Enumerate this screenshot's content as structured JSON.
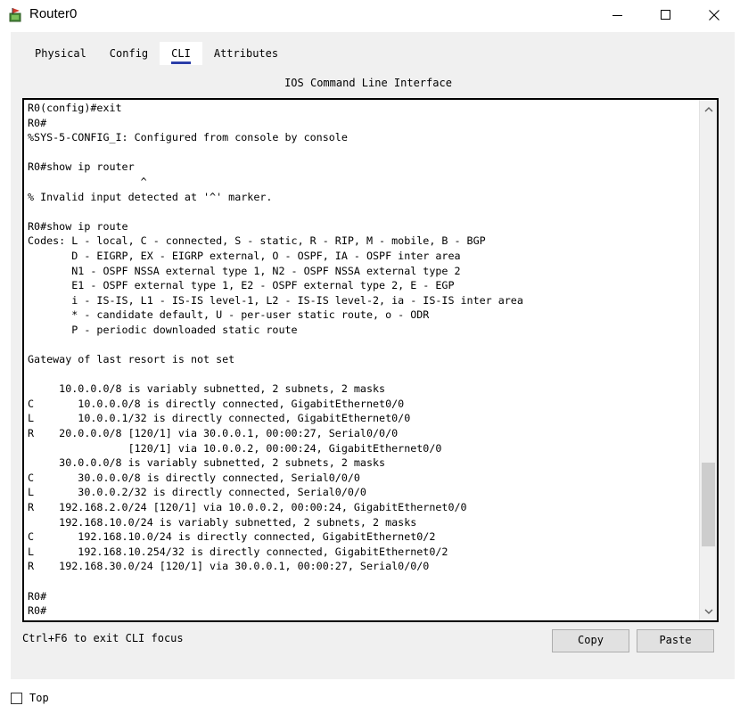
{
  "window": {
    "title": "Router0",
    "icon": "router-app-icon",
    "controls": [
      "minimize-icon",
      "maximize-icon",
      "close-icon"
    ]
  },
  "tabs": [
    {
      "label": "Physical",
      "active": false
    },
    {
      "label": "Config",
      "active": false
    },
    {
      "label": "CLI",
      "active": true
    },
    {
      "label": "Attributes",
      "active": false
    }
  ],
  "cli": {
    "heading": "IOS Command Line Interface",
    "lines": [
      "R0(config)#exit",
      "R0#",
      "%SYS-5-CONFIG_I: Configured from console by console",
      "",
      "R0#show ip router",
      "                  ^",
      "% Invalid input detected at '^' marker.",
      "",
      "R0#show ip route",
      "Codes: L - local, C - connected, S - static, R - RIP, M - mobile, B - BGP",
      "       D - EIGRP, EX - EIGRP external, O - OSPF, IA - OSPF inter area",
      "       N1 - OSPF NSSA external type 1, N2 - OSPF NSSA external type 2",
      "       E1 - OSPF external type 1, E2 - OSPF external type 2, E - EGP",
      "       i - IS-IS, L1 - IS-IS level-1, L2 - IS-IS level-2, ia - IS-IS inter area",
      "       * - candidate default, U - per-user static route, o - ODR",
      "       P - periodic downloaded static route",
      "",
      "Gateway of last resort is not set",
      "",
      "     10.0.0.0/8 is variably subnetted, 2 subnets, 2 masks",
      "C       10.0.0.0/8 is directly connected, GigabitEthernet0/0",
      "L       10.0.0.1/32 is directly connected, GigabitEthernet0/0",
      "R    20.0.0.0/8 [120/1] via 30.0.0.1, 00:00:27, Serial0/0/0",
      "                [120/1] via 10.0.0.2, 00:00:24, GigabitEthernet0/0",
      "     30.0.0.0/8 is variably subnetted, 2 subnets, 2 masks",
      "C       30.0.0.0/8 is directly connected, Serial0/0/0",
      "L       30.0.0.2/32 is directly connected, Serial0/0/0",
      "R    192.168.2.0/24 [120/1] via 10.0.0.2, 00:00:24, GigabitEthernet0/0",
      "     192.168.10.0/24 is variably subnetted, 2 subnets, 2 masks",
      "C       192.168.10.0/24 is directly connected, GigabitEthernet0/2",
      "L       192.168.10.254/32 is directly connected, GigabitEthernet0/2",
      "R    192.168.30.0/24 [120/1] via 30.0.0.1, 00:00:27, Serial0/0/0",
      "",
      "R0#",
      "R0#"
    ],
    "scroll_position": 0.86
  },
  "footer": {
    "hint": "Ctrl+F6 to exit CLI focus",
    "copy_label": "Copy",
    "paste_label": "Paste"
  },
  "top_checkbox": {
    "label": "Top",
    "checked": false
  }
}
